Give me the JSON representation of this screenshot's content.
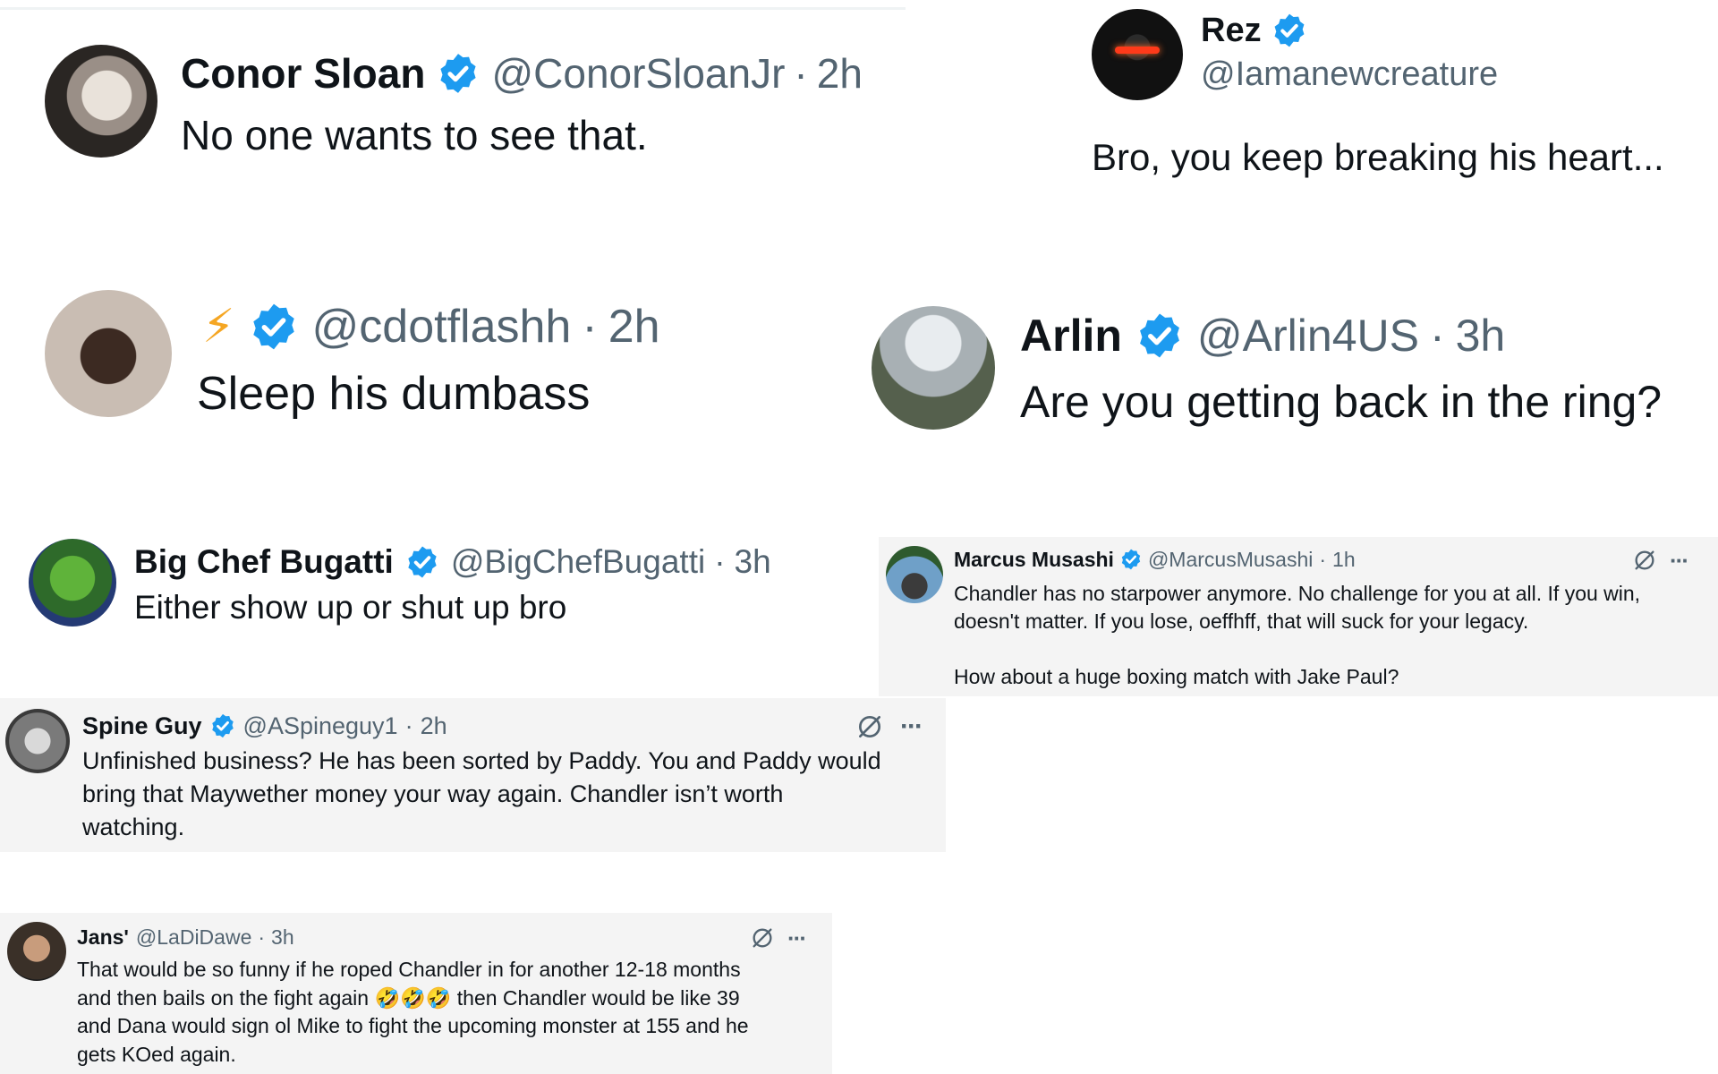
{
  "accent_color": "#1d9bf0",
  "tweets": {
    "conor": {
      "name": "Conor Sloan",
      "handle": "@ConorSloanJr",
      "sep": "·",
      "time": "2h",
      "text": "No one wants to see that.",
      "avatar": "person-photo"
    },
    "rez": {
      "name": "Rez",
      "handle": "@Iamanewcreature",
      "text": "Bro, you keep breaking his heart...",
      "avatar": "masked-face-photo"
    },
    "cdot": {
      "name": "⚡",
      "handle": "@cdotflashh",
      "sep": "·",
      "time": "2h",
      "text": "Sleep his dumbass",
      "avatar": "person-photo"
    },
    "arlin": {
      "name": "Arlin",
      "handle": "@Arlin4US",
      "sep": "·",
      "time": "3h",
      "text": "Are you getting back in the ring?",
      "avatar": "capitol-photo"
    },
    "bigchef": {
      "name": "Big Chef Bugatti",
      "handle": "@BigChefBugatti",
      "sep": "·",
      "time": "3h",
      "text": "Either show up or shut up bro",
      "avatar": "frog-cartoon"
    },
    "marcus": {
      "name": "Marcus Musashi",
      "handle": "@MarcusMusashi",
      "sep": "·",
      "time": "1h",
      "text_lines": [
        "Chandler has no starpower anymore. No challenge for you at all. If you win,",
        "doesn't matter. If you lose, oeffhff, that will suck for your legacy.",
        "",
        "How about a huge boxing match with Jake Paul?"
      ],
      "avatar": "person-palm-photo"
    },
    "spine": {
      "name": "Spine Guy",
      "handle": "@ASpineguy1",
      "sep": "·",
      "time": "2h",
      "text_lines": [
        "Unfinished business? He has been sorted by Paddy. You and Paddy would",
        "bring that Maywether money your way again. Chandler isn’t worth",
        "watching."
      ],
      "avatar": "compass-photo"
    },
    "jans": {
      "name": "Jans'",
      "handle": "@LaDiDawe",
      "sep": "·",
      "time": "3h",
      "text_lines": [
        "That would be so funny if he roped Chandler in for another 12-18 months",
        "and then bails on the fight again 🤣🤣🤣 then Chandler would be like 39",
        "and Dana would sign ol Mike to fight the upcoming monster at 155 and he",
        "gets KOed again."
      ],
      "avatar": "fighter-photo"
    }
  },
  "icons": {
    "verified": "verified-badge-icon",
    "grok": "grok-icon",
    "more": "more-options-icon",
    "more_glyph": "···"
  }
}
